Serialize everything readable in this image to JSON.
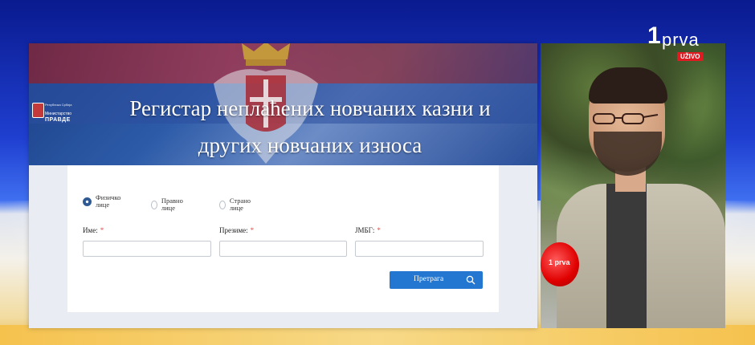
{
  "broadcast": {
    "channel_number": "1",
    "channel_name": "prva",
    "live_badge": "UŽIVO"
  },
  "site": {
    "logo": {
      "small_text": "Република Србија",
      "ministry": "Министарство",
      "ministry_name": "ПРАВДЕ"
    },
    "title_line1": "Регистар неплаћених новчаних казни и",
    "title_line2": "других новчаних износа"
  },
  "form": {
    "person_types": [
      {
        "label": "Физичко лице",
        "selected": true
      },
      {
        "label": "Правно лице",
        "selected": false
      },
      {
        "label": "Страно лице",
        "selected": false
      }
    ],
    "fields": [
      {
        "label": "Име:",
        "value": ""
      },
      {
        "label": "Презиме:",
        "value": ""
      },
      {
        "label": "ЈМБГ:",
        "value": ""
      }
    ],
    "required_mark": "*",
    "search_button": "Претрага"
  },
  "colors": {
    "accent": "#2377d1",
    "live_red": "#e11b22"
  },
  "microphone": {
    "text": "1 prva"
  }
}
